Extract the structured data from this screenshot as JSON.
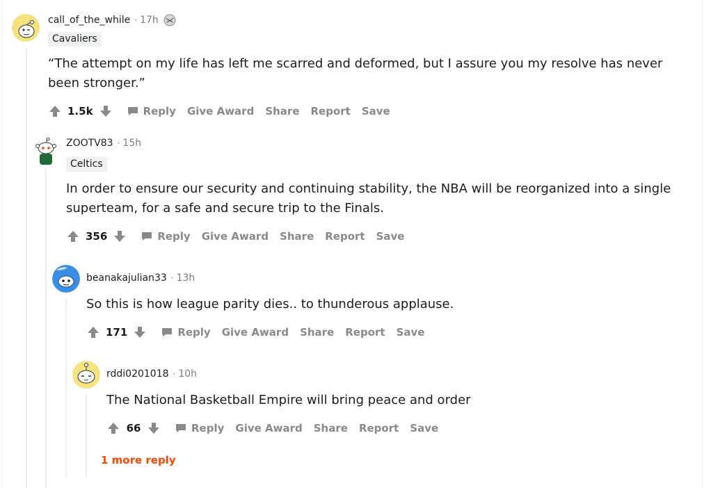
{
  "colors": {
    "accent_orange": "#ff4500",
    "action_gray": "#878a8c",
    "flair_bg": "#edeff1",
    "thread_line": "#edeff1"
  },
  "actions": {
    "reply": "Reply",
    "give_award": "Give Award",
    "share": "Share",
    "report": "Report",
    "save": "Save"
  },
  "comments": [
    {
      "username": "call_of_the_while",
      "time": "17h",
      "flair": "Cavaliers",
      "body": "“The attempt on my life has left me scarred and deformed, but I assure you my resolve has never been stronger.”",
      "score": "1.5k",
      "avatar_icon": "snoo-avatar-yellow-icon",
      "has_award": true,
      "award_icon": "award-icon"
    },
    {
      "username": "ZOOTV83",
      "time": "15h",
      "flair": "Celtics",
      "body": "In order to ensure our security and continuing stability, the NBA will be reorganized into a single superteam, for a safe and secure trip to the Finals.",
      "score": "356",
      "avatar_icon": "snoo-avatar-green-shirt-icon"
    },
    {
      "username": "beanakajulian33",
      "time": "13h",
      "body": "So this is how league parity dies.. to thunderous applause.",
      "score": "171",
      "avatar_icon": "snoo-avatar-blue-icon"
    },
    {
      "username": "rddi0201018",
      "time": "10h",
      "body": "The National Basketball Empire will bring peace and order",
      "score": "66",
      "avatar_icon": "snoo-avatar-yellow-face-icon"
    }
  ],
  "more_replies": "1 more reply"
}
